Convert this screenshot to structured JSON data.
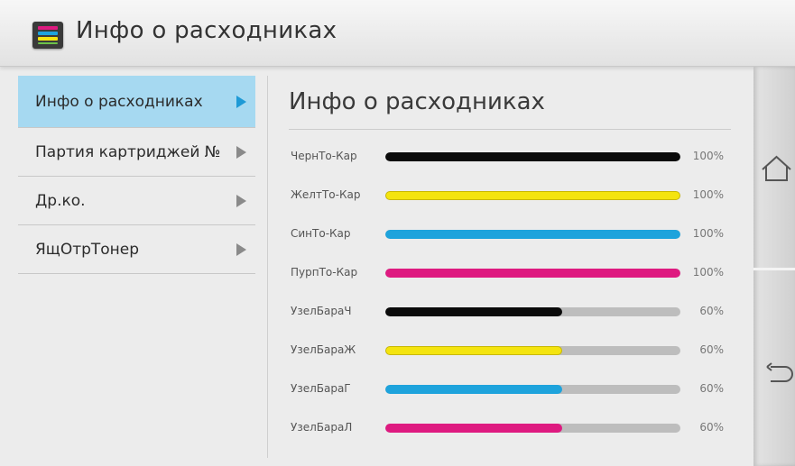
{
  "header": {
    "title": "Инфо о расходниках",
    "icon": "supplies-icon"
  },
  "menu": {
    "items": [
      {
        "label": "Инфо о расходниках",
        "active": true
      },
      {
        "label": "Партия картриджей №",
        "active": false
      },
      {
        "label": "Др.ко.",
        "active": false
      },
      {
        "label": "ЯщОтрТонер",
        "active": false
      }
    ]
  },
  "content": {
    "title": "Инфо о расходниках",
    "levels": [
      {
        "label": "ЧернТо-Кар",
        "percent": 100,
        "percent_text": "100%",
        "color": "#0b0b0b"
      },
      {
        "label": "ЖелтТо-Кар",
        "percent": 100,
        "percent_text": "100%",
        "color": "#f4e40f"
      },
      {
        "label": "СинТо-Кар",
        "percent": 100,
        "percent_text": "100%",
        "color": "#1ea3dc"
      },
      {
        "label": "ПурпТо-Кар",
        "percent": 100,
        "percent_text": "100%",
        "color": "#de1a80"
      },
      {
        "label": "УзелБараЧ",
        "percent": 60,
        "percent_text": "60%",
        "color": "#0b0b0b"
      },
      {
        "label": "УзелБараЖ",
        "percent": 60,
        "percent_text": "60%",
        "color": "#f4e40f"
      },
      {
        "label": "УзелБараГ",
        "percent": 60,
        "percent_text": "60%",
        "color": "#1ea3dc"
      },
      {
        "label": "УзелБараЛ",
        "percent": 60,
        "percent_text": "60%",
        "color": "#de1a80"
      }
    ]
  },
  "side_nav": {
    "home_icon": "home-icon",
    "back_icon": "back-icon"
  },
  "colors": {
    "accent": "#a6d9f1",
    "accent_arrow": "#1e9ad6",
    "track": "#bdbdbd"
  }
}
